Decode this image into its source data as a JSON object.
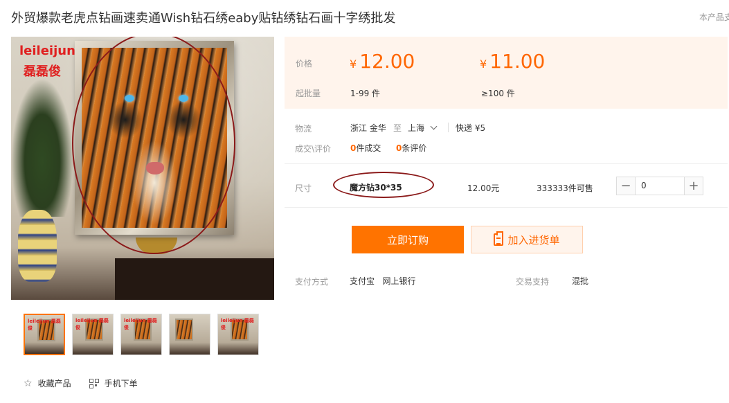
{
  "header": {
    "title": "外贸爆款老虎点钻画速卖通Wish钻石绣eaby贴钻绣钻石画十字绣批发",
    "corner_link": "本产品支"
  },
  "gallery": {
    "watermark_latin": "leileijun",
    "watermark_cn": "磊磊俊",
    "thumb_watermark": "leileijun 磊磊俊",
    "thumbnail_count": 5,
    "active_thumbnail": 1
  },
  "actions_bottom": {
    "favorite_label": "收藏产品",
    "mobile_order_label": "手机下单"
  },
  "pricing": {
    "price_label": "价格",
    "moq_label": "起批量",
    "currency_symbol": "¥",
    "tiers": [
      {
        "price": "12.00",
        "qty": "1-99 件"
      },
      {
        "price": "11.00",
        "qty": "≥100 件"
      }
    ]
  },
  "logistics": {
    "label": "物流",
    "origin": "浙江 金华",
    "to": "至",
    "destination": "上海",
    "shipping": "快递 ¥5"
  },
  "deals": {
    "label": "成交\\评价",
    "sales_count": "0",
    "sales_suffix": "件成交",
    "review_count": "0",
    "review_suffix": "条评价"
  },
  "sku": {
    "label": "尺寸",
    "name": "魔方钻30*35",
    "price": "12.00元",
    "stock": "333333件可售",
    "minus": "−",
    "plus": "+",
    "quantity": "0"
  },
  "buttons": {
    "buy_now": "立即订购",
    "add_to_list": "加入进货单"
  },
  "payment": {
    "label": "支付方式",
    "methods": "支付宝   网上银行",
    "support_label": "交易支持",
    "support_value": "混批"
  },
  "colors": {
    "accent": "#ff7300",
    "price": "#ff6600",
    "annotation": "#8b1a1a"
  }
}
